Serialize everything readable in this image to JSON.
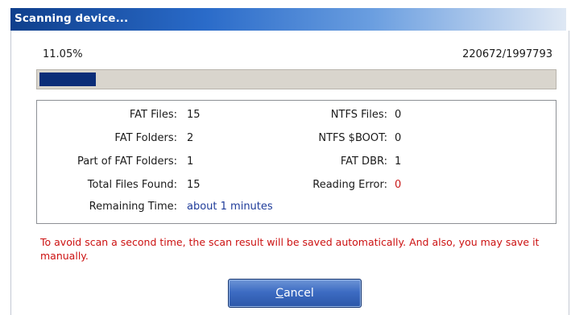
{
  "window": {
    "title": "Scanning device..."
  },
  "progress": {
    "percent_text": "11.05%",
    "count_text": "220672/1997793",
    "fraction": 0.1105
  },
  "stats_left": [
    {
      "label": "FAT Files:",
      "value": "15"
    },
    {
      "label": "FAT Folders:",
      "value": "2"
    },
    {
      "label": "Part of FAT Folders:",
      "value": "1"
    },
    {
      "label": "Total Files Found:",
      "value": "15"
    },
    {
      "label": "Remaining Time:",
      "value": "about 1 minutes"
    }
  ],
  "stats_right": [
    {
      "label": "NTFS Files:",
      "value": "0"
    },
    {
      "label": "NTFS $BOOT:",
      "value": "0"
    },
    {
      "label": "FAT DBR:",
      "value": "1"
    },
    {
      "label": "Reading Error:",
      "value": "0"
    }
  ],
  "note": "To avoid scan a second time, the scan result will be saved automatically. And also, you may save it manually.",
  "buttons": {
    "cancel_first": "C",
    "cancel_rest": "ancel"
  },
  "colors": {
    "title_bar": "#0f3f8c",
    "progress_fill": "#0b2d78",
    "error_red": "#c81a1a",
    "link_blue": "#1f3c9a"
  }
}
